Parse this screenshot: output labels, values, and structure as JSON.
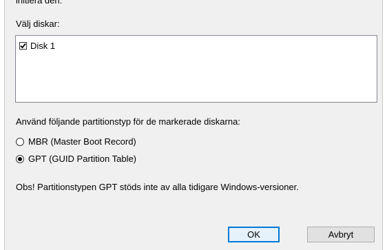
{
  "dialog": {
    "intro_text": "initiera den:",
    "select_disks_label": "Välj diskar:",
    "disks": [
      {
        "label": "Disk 1",
        "checked": true
      }
    ],
    "partition_type_label": "Använd följande partitionstyp för de markerade diskarna:",
    "partition_options": [
      {
        "label": "MBR (Master Boot Record)",
        "selected": false
      },
      {
        "label": "GPT (GUID Partition Table)",
        "selected": true
      }
    ],
    "note": "Obs! Partitionstypen GPT stöds inte av alla tidigare Windows-versioner.",
    "ok_label": "OK",
    "cancel_label": "Avbryt"
  },
  "colors": {
    "dialog_background": "#f0f0f0",
    "default_button_border": "#0078d7"
  }
}
